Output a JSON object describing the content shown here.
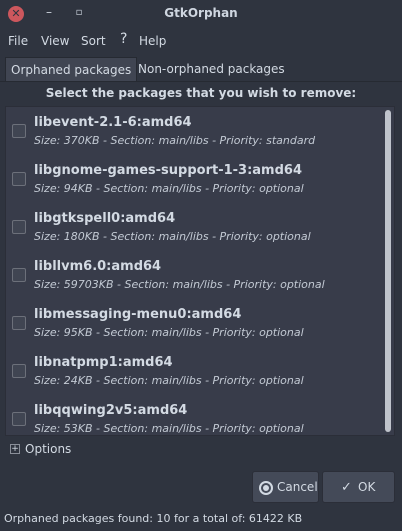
{
  "window": {
    "title": "GtkOrphan"
  },
  "menu": {
    "file": "File",
    "view": "View",
    "sort": "Sort",
    "help": "Help"
  },
  "tabs": [
    {
      "label": "Orphaned packages",
      "active": true
    },
    {
      "label": "Non-orphaned packages",
      "active": false
    }
  ],
  "heading": "Select the packages that you wish to remove:",
  "packages": [
    {
      "name": "libevent-2.1-6:amd64",
      "info": "Size: 370KB - Section: main/libs - Priority: standard",
      "checked": false
    },
    {
      "name": "libgnome-games-support-1-3:amd64",
      "info": "Size: 94KB - Section: main/libs - Priority: optional",
      "checked": false
    },
    {
      "name": "libgtkspell0:amd64",
      "info": "Size: 180KB - Section: main/libs - Priority: optional",
      "checked": false
    },
    {
      "name": "libllvm6.0:amd64",
      "info": "Size: 59703KB - Section: main/libs - Priority: optional",
      "checked": false
    },
    {
      "name": "libmessaging-menu0:amd64",
      "info": "Size: 95KB - Section: main/libs - Priority: optional",
      "checked": false
    },
    {
      "name": "libnatpmp1:amd64",
      "info": "Size: 24KB - Section: main/libs - Priority: optional",
      "checked": false
    },
    {
      "name": "libqqwing2v5:amd64",
      "info": "Size: 53KB - Section: main/libs - Priority: optional",
      "checked": false
    }
  ],
  "options": {
    "label": "Options",
    "expanded": false
  },
  "buttons": {
    "cancel": "Cancel",
    "ok": "OK"
  },
  "status": "Orphaned packages found: 10 for a total of: 61422 KB",
  "colors": {
    "background": "#2f343f",
    "list_background": "#383c4a",
    "close_button": "#cc575d"
  }
}
